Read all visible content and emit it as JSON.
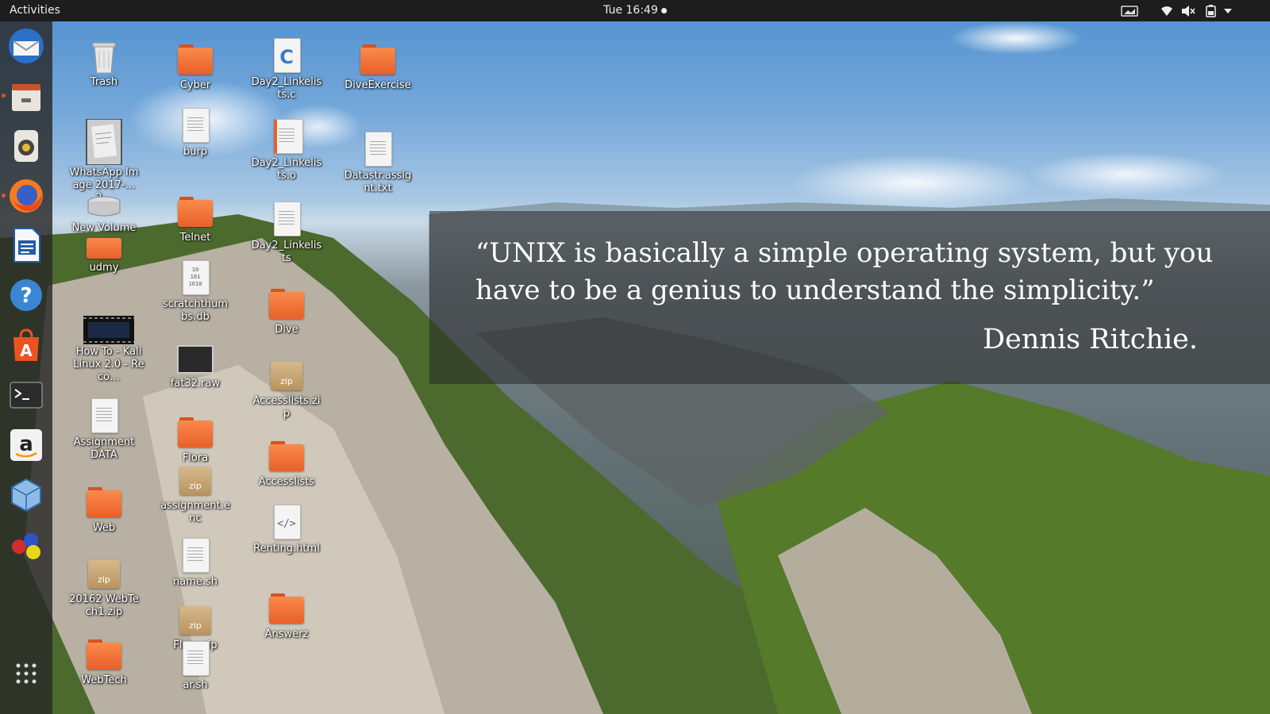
{
  "topbar": {
    "activities_label": "Activities",
    "clock": "Tue 16:49",
    "tray_icons": [
      "screen-icon",
      "wifi-icon",
      "volume-muted-icon",
      "battery-icon",
      "chevron-down-icon"
    ]
  },
  "dock": {
    "items": [
      {
        "name": "thunderbird-icon",
        "running": false
      },
      {
        "name": "files-icon",
        "running": true
      },
      {
        "name": "rhythmbox-icon",
        "running": false
      },
      {
        "name": "firefox-icon",
        "running": true
      },
      {
        "name": "libreoffice-writer-icon",
        "running": false
      },
      {
        "name": "help-icon",
        "running": false
      },
      {
        "name": "software-center-icon",
        "running": false
      },
      {
        "name": "terminal-icon",
        "running": false
      },
      {
        "name": "amazon-icon",
        "running": false
      },
      {
        "name": "virtualbox-icon",
        "running": false
      },
      {
        "name": "game-balls-icon",
        "running": false
      },
      {
        "name": "show-applications-icon",
        "running": false
      }
    ]
  },
  "desktop_icons": [
    {
      "label": "Trash",
      "type": "trash"
    },
    {
      "label": "WhatsApp Image 2017-…2…",
      "type": "image"
    },
    {
      "label": "New Volume",
      "type": "drive"
    },
    {
      "label": "udmy",
      "type": "folder"
    },
    {
      "label": "How To - Kali Linux 2.0 - Reco…",
      "type": "video"
    },
    {
      "label": "Assignment DATA",
      "type": "doc"
    },
    {
      "label": "Web",
      "type": "folder"
    },
    {
      "label": "20162 WebTech1.zip",
      "type": "zip"
    },
    {
      "label": "WebTech",
      "type": "folder"
    },
    {
      "label": "Cyber",
      "type": "folder"
    },
    {
      "label": "burp",
      "type": "doc"
    },
    {
      "label": "Telnet",
      "type": "folder"
    },
    {
      "label": "scratchthumbs.db",
      "type": "binary"
    },
    {
      "label": "fat32.raw",
      "type": "raw"
    },
    {
      "label": "Flora",
      "type": "folder"
    },
    {
      "label": "assignment.enc",
      "type": "zip"
    },
    {
      "label": "name.sh",
      "type": "doc"
    },
    {
      "label": "Flora.zip",
      "type": "zip"
    },
    {
      "label": "ar.sh",
      "type": "doc"
    },
    {
      "label": "Day2_Linkelists.c",
      "type": "csource"
    },
    {
      "label": "Day2_Linkelists.o",
      "type": "doc"
    },
    {
      "label": "Day2_Linkelists",
      "type": "doc"
    },
    {
      "label": "Dive",
      "type": "folder"
    },
    {
      "label": "Accesslists.zip",
      "type": "zip"
    },
    {
      "label": "Accesslists",
      "type": "folder"
    },
    {
      "label": "Renting.html",
      "type": "html"
    },
    {
      "label": "Answerz",
      "type": "folder"
    },
    {
      "label": "DiveExercise",
      "type": "folder"
    },
    {
      "label": "Datastr.assignt.txt",
      "type": "doc"
    }
  ],
  "wallpaper_quote": {
    "text": "“UNIX is basically a simple operating system, but you have to be a genius to understand the simplicity.”",
    "author": "Dennis Ritchie."
  },
  "colors": {
    "topbar": "#1d1d1d",
    "folder_orange": "#f0733a",
    "running_indicator": "#e95420"
  }
}
